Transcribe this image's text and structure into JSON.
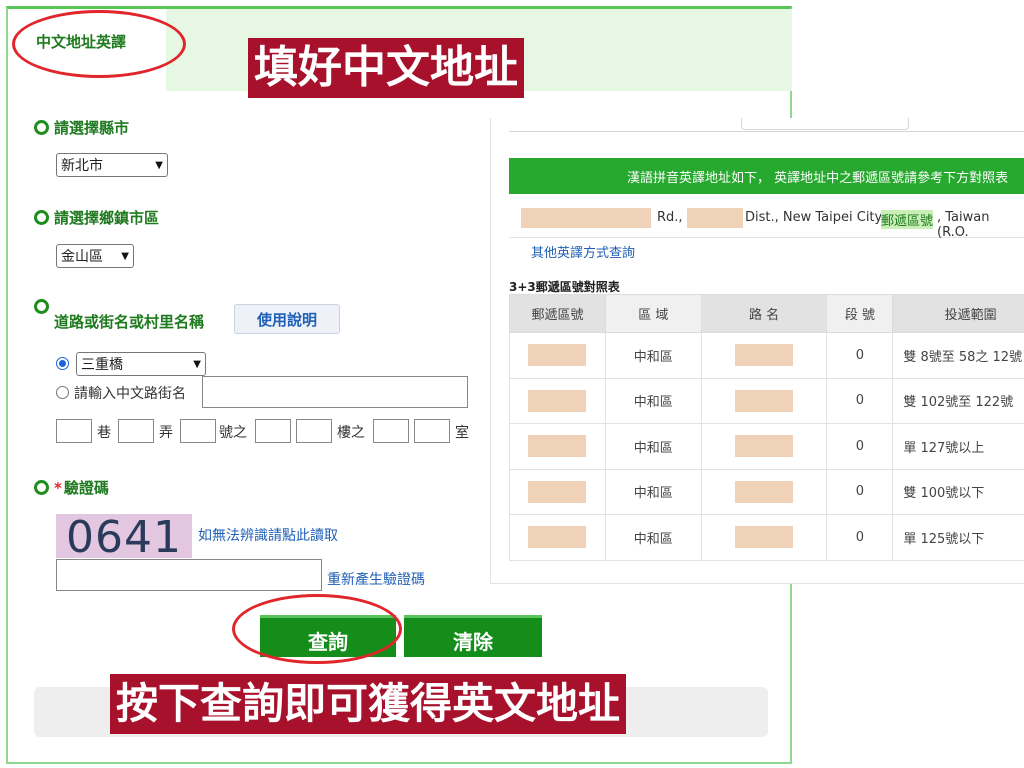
{
  "form": {
    "title": "中文地址英譯",
    "city_label": "請選擇縣市",
    "city_value": "新北市",
    "district_label": "請選擇鄉鎮市區",
    "district_value": "金山區",
    "road_label": "道路或街名或村里名稱",
    "guide_button": "使用說明",
    "road_select_value": "三重橋",
    "road_input_label": "請輸入中文路街名",
    "units": [
      "巷",
      "弄",
      "號之",
      "樓之",
      "室"
    ],
    "captcha_label": "驗證碼",
    "captcha_required": "*",
    "captcha_image_text": "0641",
    "captcha_unreadable_link": "如無法辨識請點此讀取",
    "captcha_regen_link": "重新產生驗證碼",
    "query_button": "查詢",
    "clear_button": "清除"
  },
  "captions": {
    "top": "填好中文地址",
    "bottom": "按下查詢即可獲得英文地址"
  },
  "result": {
    "header_text": "漢語拼音英譯地址如下， 英譯地址中之郵遞區號請參考下方對照表",
    "address_road": "Rd.,",
    "address_dist": "Dist., New Taipei City",
    "address_zip_label": "郵遞區號",
    "address_country": ", Taiwan (R.O.",
    "other_link": "其他英譯方式查詢",
    "table_title": "3+3郵遞區號對照表",
    "columns": [
      "郵遞區號",
      "區 域",
      "路 名",
      "段 號",
      "投遞範圍"
    ],
    "rows": [
      {
        "area": "中和區",
        "section": "0",
        "range": "雙 8號至 58之 12號"
      },
      {
        "area": "中和區",
        "section": "0",
        "range": "雙 102號至 122號"
      },
      {
        "area": "中和區",
        "section": "0",
        "range": "單 127號以上"
      },
      {
        "area": "中和區",
        "section": "0",
        "range": "雙 100號以下"
      },
      {
        "area": "中和區",
        "section": "0",
        "range": "單 125號以下"
      }
    ]
  },
  "colors": {
    "accent_green": "#148d1a",
    "label_green": "#1f7a1f",
    "caption_red": "#a7112c",
    "annotation_red": "#e0262b",
    "link_blue": "#1f5fb5"
  }
}
